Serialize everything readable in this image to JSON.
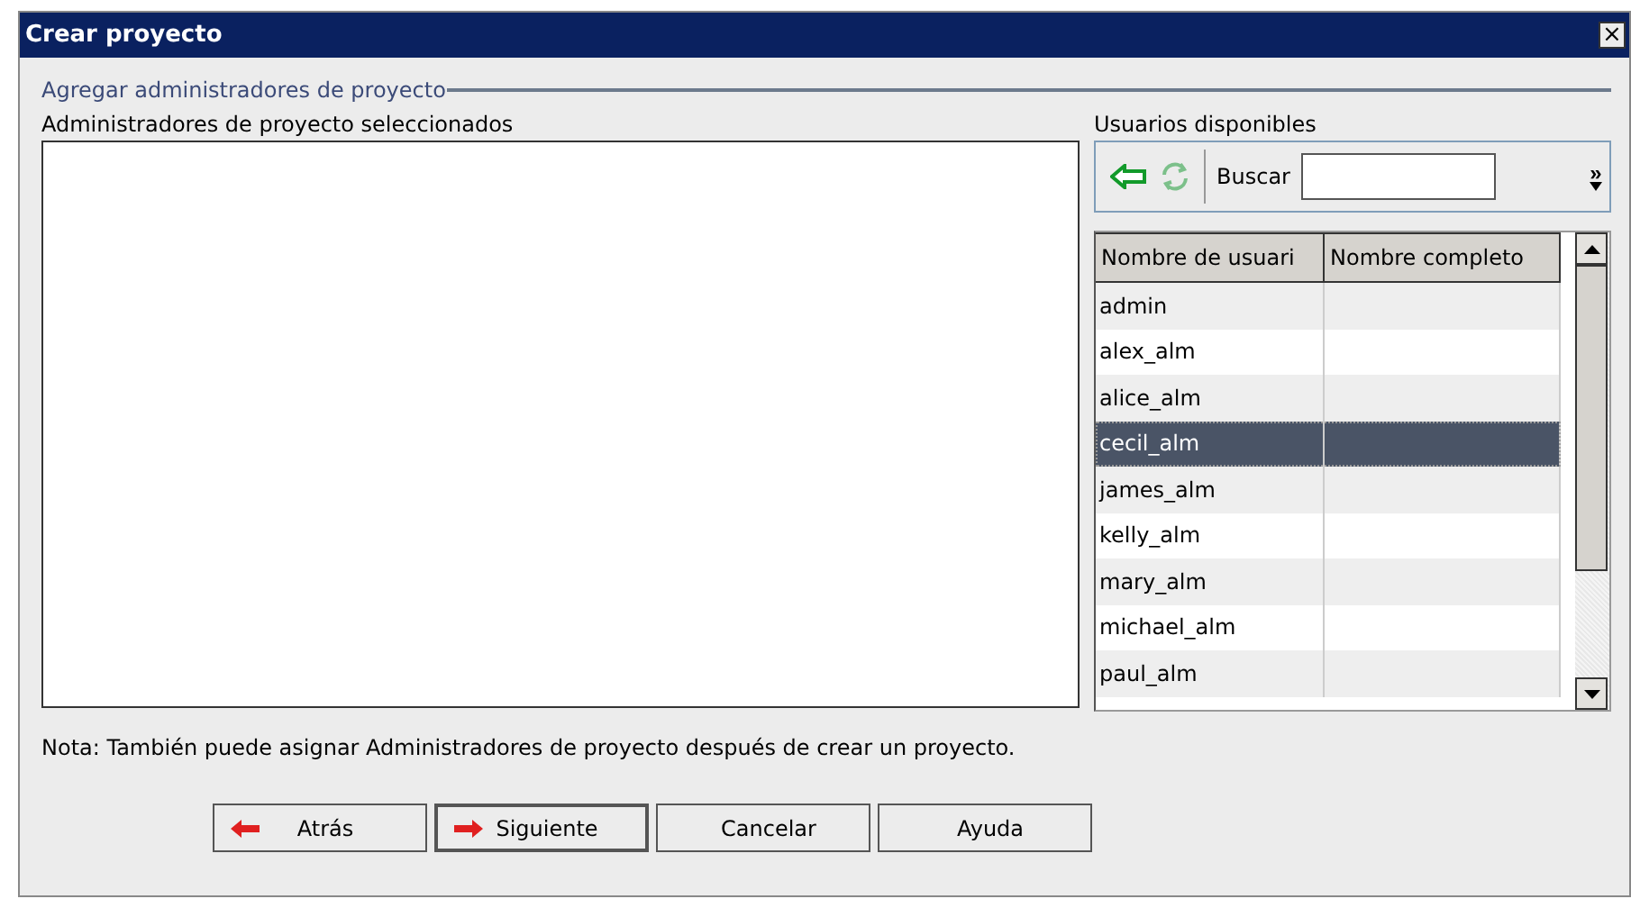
{
  "window": {
    "title": "Crear proyecto",
    "close": "×"
  },
  "section": {
    "title": "Agregar administradores de proyecto"
  },
  "selected_list": {
    "label": "Administradores de proyecto seleccionados"
  },
  "available": {
    "label": "Usuarios disponibles",
    "search_label": "Buscar",
    "more": "»",
    "columns": [
      "Nombre de usuari",
      "Nombre completo"
    ],
    "rows": [
      {
        "user": "admin",
        "selected": false
      },
      {
        "user": "alex_alm",
        "selected": false
      },
      {
        "user": "alice_alm",
        "selected": false
      },
      {
        "user": "cecil_alm",
        "selected": true
      },
      {
        "user": "james_alm",
        "selected": false
      },
      {
        "user": "kelly_alm",
        "selected": false
      },
      {
        "user": "mary_alm",
        "selected": false
      },
      {
        "user": "michael_alm",
        "selected": false
      },
      {
        "user": "paul_alm",
        "selected": false
      }
    ]
  },
  "note": "Nota: También puede asignar Administradores de proyecto después de crear un proyecto.",
  "buttons": [
    {
      "label": "Atrás",
      "kind": "back",
      "default": false
    },
    {
      "label": "Siguiente",
      "kind": "next",
      "default": true
    },
    {
      "label": "Cancelar",
      "kind": "plain",
      "default": false
    },
    {
      "label": "Ayuda",
      "kind": "plain",
      "default": false
    }
  ]
}
